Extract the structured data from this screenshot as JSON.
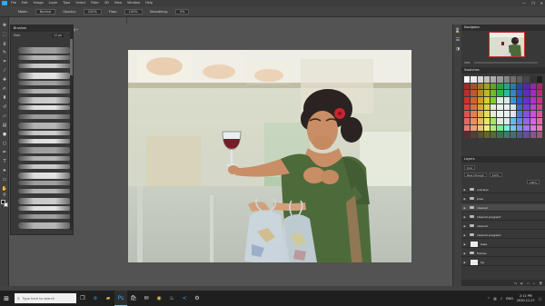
{
  "app": {
    "menu": [
      "File",
      "Edit",
      "Image",
      "Layer",
      "Type",
      "Select",
      "Filter",
      "3D",
      "View",
      "Window",
      "Help"
    ],
    "window_controls": [
      "—",
      "❐",
      "✕"
    ]
  },
  "options_bar": {
    "mode_label": "Mode:",
    "mode_value": "Normal",
    "opacity_label": "Opacity:",
    "opacity_value": "100%",
    "flow_label": "Flow:",
    "flow_value": "100%",
    "smoothing_label": "Smoothing:",
    "smoothing_value": "0%"
  },
  "document": {
    "tab_title": "CH48B MARIA.psd @ 50% (cleaned, RGB/8) *",
    "status": "33.33%   Doc: 46.3M/2.76G"
  },
  "brushes_panel": {
    "title": "Brushes",
    "size_label": "Size:",
    "size_value": "12 px"
  },
  "right_panels": {
    "navigator_title": "Navigator",
    "navigator_zoom": "33%",
    "swatches_title": "Swatches",
    "layers_title": "Layers",
    "kind_label": "Kind",
    "blend_mode": "Pass Through",
    "opacity_value": "100%",
    "fill_value": "100%",
    "layers": [
      {
        "name": "overlays",
        "type": "folder",
        "selected": false
      },
      {
        "name": "pose",
        "type": "folder",
        "selected": false
      },
      {
        "name": "cleaned",
        "type": "folder",
        "selected": true
      },
      {
        "name": "cleaned pregnant",
        "type": "folder",
        "selected": false
      },
      {
        "name": "cleaned",
        "type": "folder",
        "selected": false
      },
      {
        "name": "cleaned pregnant",
        "type": "folder",
        "selected": false
      },
      {
        "name": "base",
        "type": "layer",
        "selected": false
      },
      {
        "name": "frames",
        "type": "folder",
        "selected": false
      },
      {
        "name": "bg",
        "type": "layer",
        "selected": false
      }
    ],
    "layer_actions": [
      "fx",
      "◐",
      "▭",
      "+",
      "🗑"
    ]
  },
  "taskbar": {
    "search_placeholder": "Type here to search",
    "apps": [
      "task-view",
      "edge",
      "explorer",
      "photoshop",
      "store",
      "mail",
      "chrome",
      "steam",
      "vscode",
      "settings"
    ],
    "tray": [
      "^",
      "ENG"
    ],
    "time": "2:11 PM",
    "date": "2020-11-27"
  },
  "colors": {
    "accent": "#31a8ff",
    "ui_dark": "#383838",
    "ui_bg": "#535353",
    "dress_green": "#4d6a3b",
    "wine_red": "#7a1b2a"
  }
}
